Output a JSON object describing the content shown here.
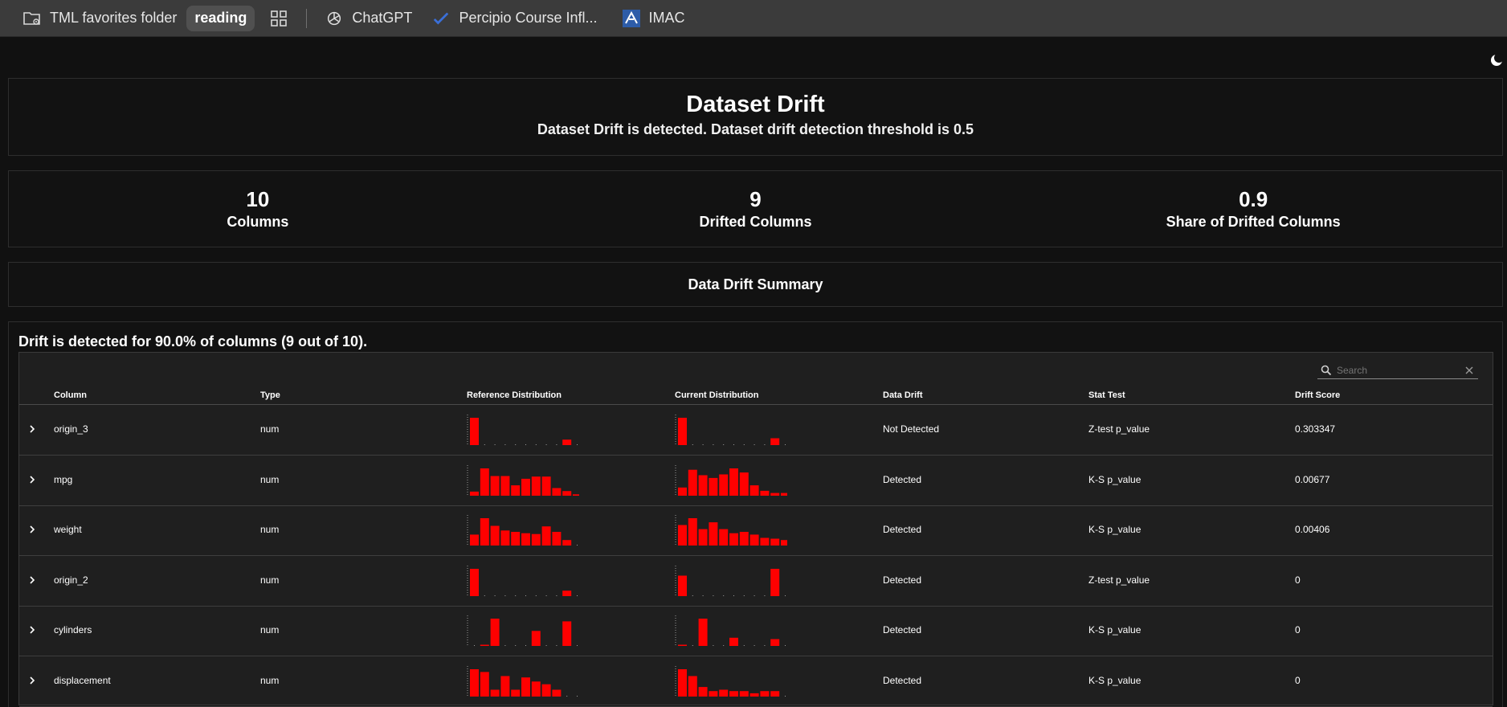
{
  "bookmarks": [
    {
      "label": "TML favorites folder",
      "icon": "folder-settings-icon"
    },
    {
      "label": "reading",
      "icon": ""
    },
    {
      "label": "",
      "icon": "apps-grid-icon"
    },
    {
      "label": "ChatGPT",
      "icon": "chatgpt-icon"
    },
    {
      "label": "Percipio Course Infl...",
      "icon": "percipio-icon"
    },
    {
      "label": "IMAC",
      "icon": "imac-icon"
    }
  ],
  "report": {
    "title": "Dataset Drift",
    "subtitle": "Dataset Drift is detected. Dataset drift detection threshold is 0.5",
    "counters": [
      {
        "value": "10",
        "label": "Columns"
      },
      {
        "value": "9",
        "label": "Drifted Columns"
      },
      {
        "value": "0.9",
        "label": "Share of Drifted Columns"
      }
    ],
    "summary_title": "Data Drift Summary",
    "drift_description": "Drift is detected for 90.0% of columns (9 out of 10)."
  },
  "table": {
    "search_placeholder": "Search",
    "headers": {
      "column": "Column",
      "type": "Type",
      "ref": "Reference Distribution",
      "cur": "Current Distribution",
      "drift": "Data Drift",
      "stat": "Stat Test",
      "score": "Drift Score"
    },
    "rows": [
      {
        "column": "origin_3",
        "type": "num",
        "drift": "Not Detected",
        "stat": "Z-test p_value",
        "score": "0.303347",
        "ref": [
          1,
          0,
          0,
          0,
          0,
          0,
          0,
          0,
          0,
          0.2,
          0
        ],
        "cur": [
          1,
          0,
          0,
          0,
          0,
          0,
          0,
          0,
          0,
          0.25,
          0
        ]
      },
      {
        "column": "mpg",
        "type": "num",
        "drift": "Detected",
        "stat": "K-S p_value",
        "score": "0.00677",
        "ref": [
          0.15,
          1,
          0.72,
          0.72,
          0.38,
          0.62,
          0.7,
          0.7,
          0.28,
          0.17,
          0.05
        ],
        "cur": [
          0.3,
          0.95,
          0.75,
          0.65,
          0.78,
          1.0,
          0.85,
          0.38,
          0.18,
          0.1,
          0.1
        ]
      },
      {
        "column": "weight",
        "type": "num",
        "drift": "Detected",
        "stat": "K-S p_value",
        "score": "0.00406",
        "ref": [
          0.4,
          1.0,
          0.72,
          0.55,
          0.5,
          0.45,
          0.42,
          0.7,
          0.5,
          0.2,
          0
        ],
        "cur": [
          0.75,
          1.0,
          0.6,
          0.85,
          0.6,
          0.45,
          0.5,
          0.4,
          0.28,
          0.25,
          0.2
        ]
      },
      {
        "column": "origin_2",
        "type": "num",
        "drift": "Detected",
        "stat": "Z-test p_value",
        "score": "0",
        "ref": [
          1,
          0,
          0,
          0,
          0,
          0,
          0,
          0,
          0,
          0.2,
          0
        ],
        "cur": [
          0.75,
          0,
          0,
          0,
          0,
          0,
          0,
          0,
          0,
          1,
          0
        ]
      },
      {
        "column": "cylinders",
        "type": "num",
        "drift": "Detected",
        "stat": "K-S p_value",
        "score": "0",
        "ref": [
          0,
          0.02,
          1,
          0,
          0,
          0,
          0.55,
          0,
          0,
          0.9,
          0
        ],
        "cur": [
          0.03,
          0,
          1,
          0,
          0,
          0.3,
          0,
          0,
          0,
          0.25,
          0
        ]
      },
      {
        "column": "displacement",
        "type": "num",
        "drift": "Detected",
        "stat": "K-S p_value",
        "score": "0",
        "ref": [
          1,
          0.9,
          0.25,
          0.75,
          0.25,
          0.7,
          0.55,
          0.45,
          0.25,
          0,
          0
        ],
        "cur": [
          1,
          0.75,
          0.35,
          0.2,
          0.25,
          0.2,
          0.2,
          0.12,
          0.2,
          0.2,
          0
        ]
      }
    ]
  },
  "colors": {
    "histogram": "#ff0000",
    "background": "#111111",
    "bookmarks_bar": "#3b3b3b"
  }
}
